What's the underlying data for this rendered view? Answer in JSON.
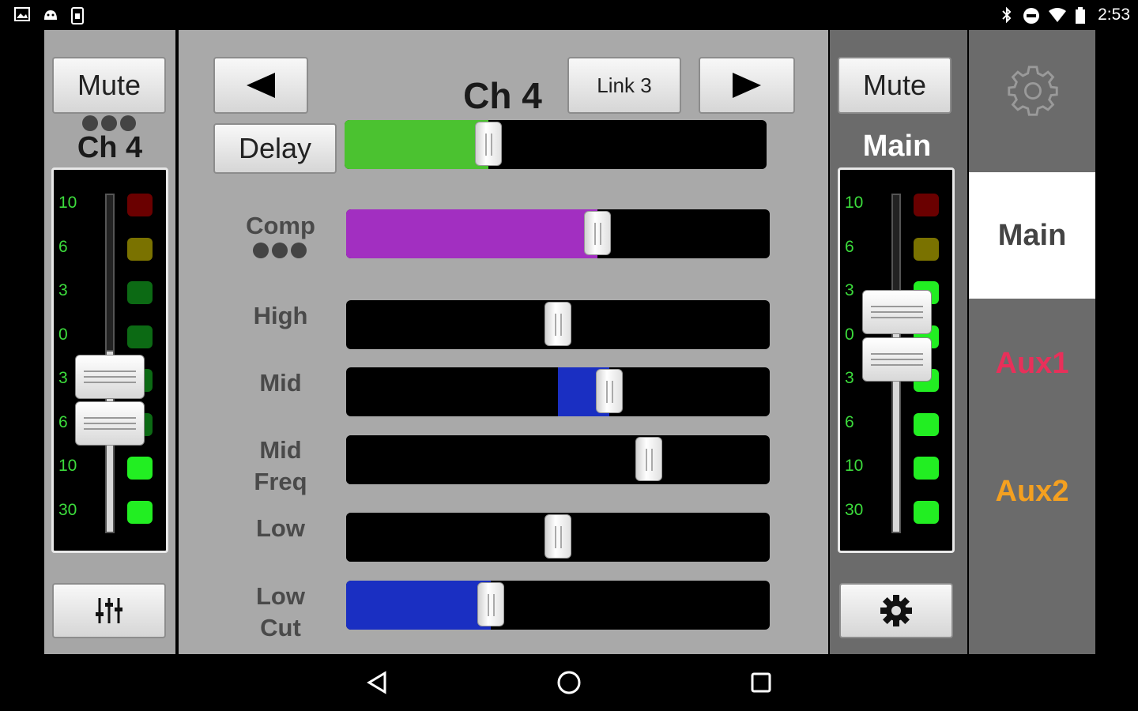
{
  "status": {
    "time": "2:53"
  },
  "left_strip": {
    "mute_label": "Mute",
    "channel_label": "Ch 4",
    "scale": [
      "10",
      "6",
      "3",
      "0",
      "3",
      "6",
      "10",
      "30"
    ],
    "fader_level": 0.42
  },
  "center": {
    "channel_title": "Ch 4",
    "link_label": "Link 3",
    "delay_label": "Delay",
    "sliders": [
      {
        "label": "Comp",
        "value": 0.6,
        "fill_color": "#a22fc1"
      },
      {
        "label": "High",
        "value": 0.5,
        "fill_color": "#1a2fc2"
      },
      {
        "label": "Mid",
        "value": 0.63,
        "fill_color": "#1a2fc2"
      },
      {
        "label": "Mid\nFreq",
        "value": 0.73,
        "fill_color": "#000000"
      },
      {
        "label": "Low",
        "value": 0.5,
        "fill_color": "#000000"
      },
      {
        "label": "Low\nCut",
        "value": 0.33,
        "fill_color": "#1a2fc2"
      }
    ],
    "delay_value": 0.33,
    "delay_fill_color": "#4bc230"
  },
  "right_strip": {
    "mute_label": "Mute",
    "channel_label": "Main",
    "scale": [
      "10",
      "6",
      "3",
      "0",
      "3",
      "6",
      "10",
      "30"
    ],
    "fader_level": 0.62
  },
  "buses": [
    {
      "label": "Main",
      "color": "#444444",
      "selected": true
    },
    {
      "label": "Aux1",
      "color": "#e8305a",
      "selected": false
    },
    {
      "label": "Aux2",
      "color": "#f4a020",
      "selected": false
    }
  ],
  "colors": {
    "led_red": "#6a0000",
    "led_yellow": "#7a7200",
    "led_green_dim": "#0c6a14",
    "led_green": "#22ee22"
  }
}
